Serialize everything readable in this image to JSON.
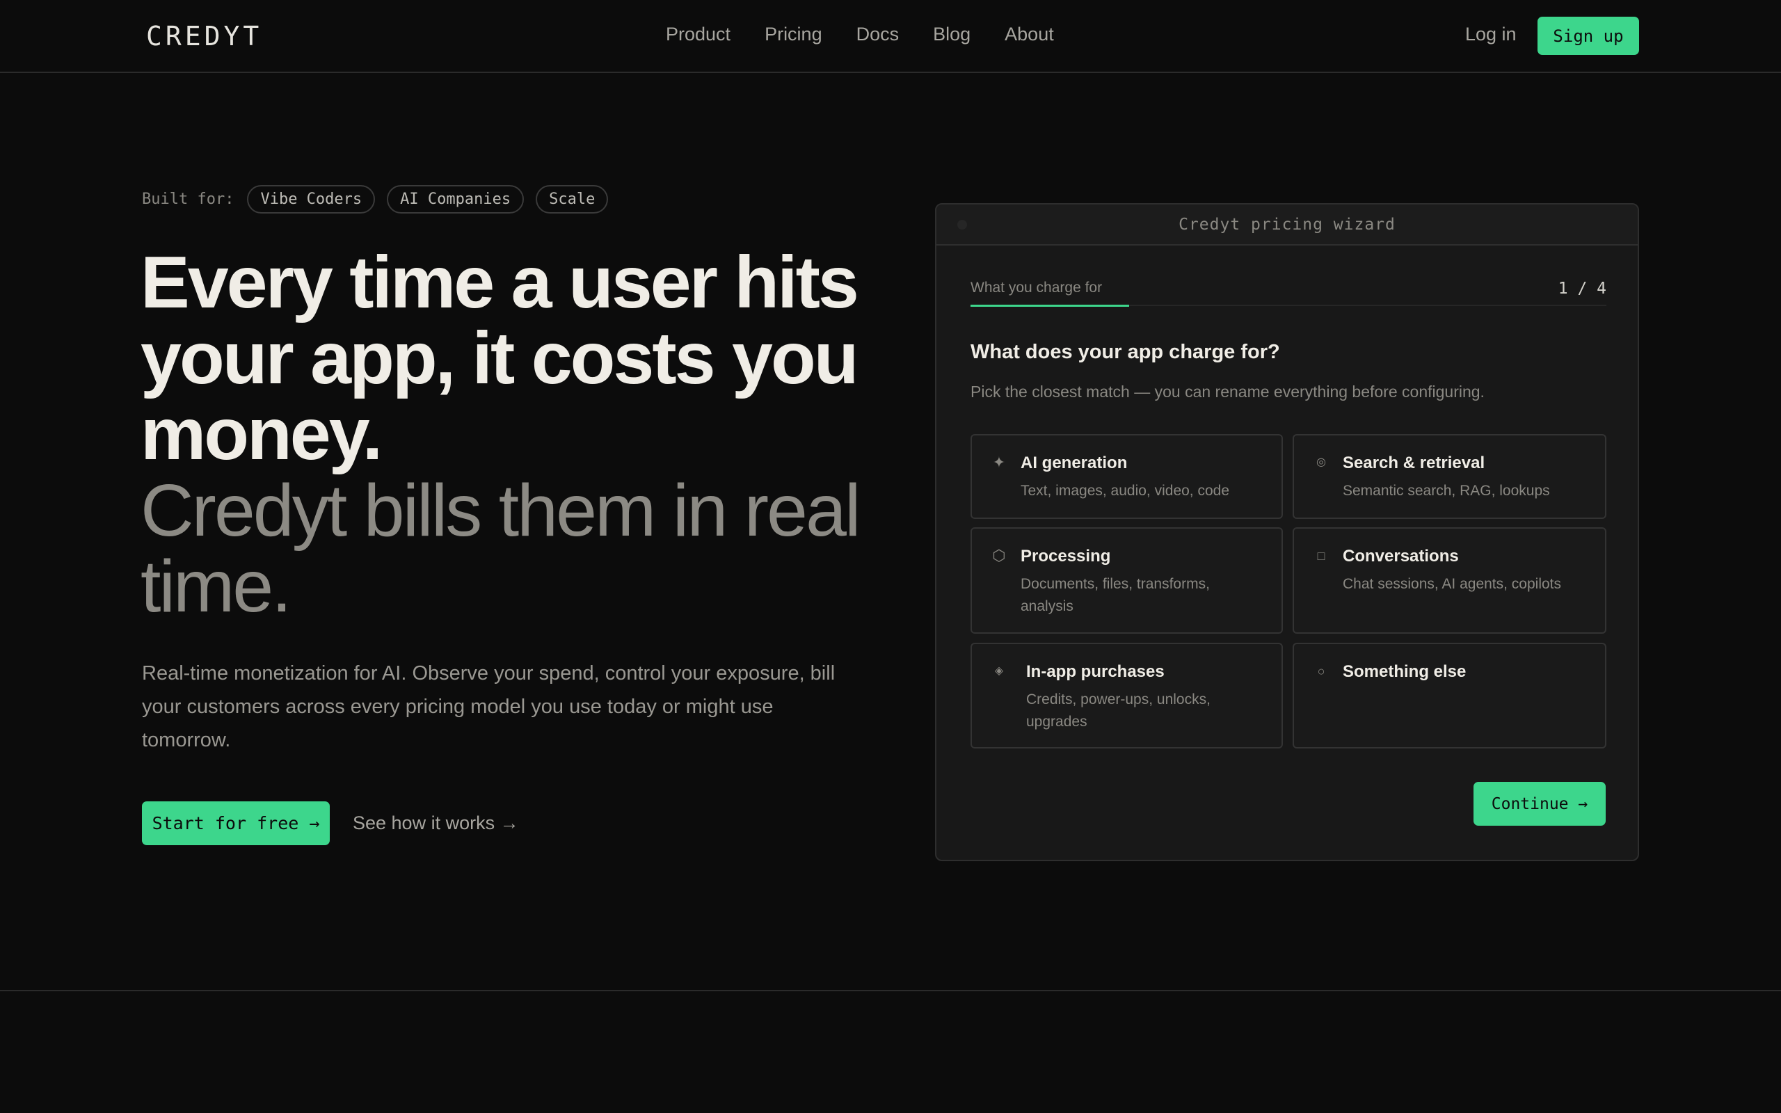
{
  "nav": {
    "logo": "CREDYT",
    "links": [
      "Product",
      "Pricing",
      "Docs",
      "Blog",
      "About"
    ],
    "login": "Log in",
    "signup": "Sign up"
  },
  "hero": {
    "built_for_label": "Built for:",
    "built_for": [
      "Vibe Coders",
      "AI Companies",
      "Scale"
    ],
    "headline": "Every time a user hits your app, it costs you money.",
    "subhead": "Credyt bills them in real time.",
    "lede": "Real-time monetization for AI. Observe your spend, control your exposure, bill your customers across every pricing model you use today or might use tomorrow.",
    "cta_primary": "Start for free →",
    "cta_secondary": "See how it works →"
  },
  "wizard": {
    "title": "Credyt pricing wizard",
    "step_label": "What you charge for",
    "step_count": "1 / 4",
    "question": "What does your app charge for?",
    "hint": "Pick the closest match — you can rename everything before configuring.",
    "options": [
      {
        "icon": "sparkle-icon",
        "glyph": "✦",
        "title": "AI generation",
        "desc": "Text, images, audio, video, code"
      },
      {
        "icon": "ring-icon",
        "glyph": "◎",
        "title": "Search & retrieval",
        "desc": "Semantic search, RAG, lookups"
      },
      {
        "icon": "hexagon-icon",
        "glyph": "⬡",
        "title": "Processing",
        "desc": "Documents, files, transforms, analysis"
      },
      {
        "icon": "square-icon",
        "glyph": "□",
        "title": "Conversations",
        "desc": "Chat sessions, AI agents, copilots"
      },
      {
        "icon": "diamond-icon",
        "glyph": "◈",
        "title": "In-app purchases",
        "desc": "Credits, power-ups, unlocks, upgrades"
      },
      {
        "icon": "circle-icon",
        "glyph": "○",
        "title": "Something else",
        "desc": ""
      }
    ],
    "continue": "Continue →"
  },
  "colors": {
    "background": "#0c0c0c",
    "accent": "#3dd68c",
    "card": "#181818"
  }
}
